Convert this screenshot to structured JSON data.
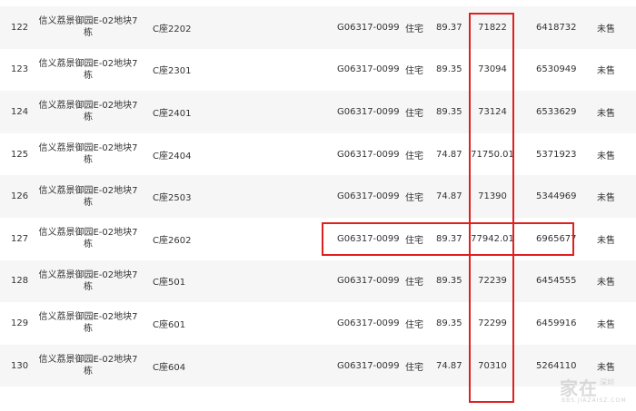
{
  "table": {
    "rows": [
      {
        "idx": "122",
        "name": "信义荔景御园E-02地块7栋",
        "unit": "C座2202",
        "code": "G06317-0099",
        "type": "住宅",
        "area": "89.37",
        "price": "71822",
        "total": "6418732",
        "status": "未售"
      },
      {
        "idx": "123",
        "name": "信义荔景御园E-02地块7栋",
        "unit": "C座2301",
        "code": "G06317-0099",
        "type": "住宅",
        "area": "89.35",
        "price": "73094",
        "total": "6530949",
        "status": "未售"
      },
      {
        "idx": "124",
        "name": "信义荔景御园E-02地块7栋",
        "unit": "C座2401",
        "code": "G06317-0099",
        "type": "住宅",
        "area": "89.35",
        "price": "73124",
        "total": "6533629",
        "status": "未售"
      },
      {
        "idx": "125",
        "name": "信义荔景御园E-02地块7栋",
        "unit": "C座2404",
        "code": "G06317-0099",
        "type": "住宅",
        "area": "74.87",
        "price": "71750.01",
        "total": "5371923",
        "status": "未售"
      },
      {
        "idx": "126",
        "name": "信义荔景御园E-02地块7栋",
        "unit": "C座2503",
        "code": "G06317-0099",
        "type": "住宅",
        "area": "74.87",
        "price": "71390",
        "total": "5344969",
        "status": "未售"
      },
      {
        "idx": "127",
        "name": "信义荔景御园E-02地块7栋",
        "unit": "C座2602",
        "code": "G06317-0099",
        "type": "住宅",
        "area": "89.37",
        "price": "77942.01",
        "total": "6965677",
        "status": "未售"
      },
      {
        "idx": "128",
        "name": "信义荔景御园E-02地块7栋",
        "unit": "C座501",
        "code": "G06317-0099",
        "type": "住宅",
        "area": "89.35",
        "price": "72239",
        "total": "6454555",
        "status": "未售"
      },
      {
        "idx": "129",
        "name": "信义荔景御园E-02地块7栋",
        "unit": "C座601",
        "code": "G06317-0099",
        "type": "住宅",
        "area": "89.35",
        "price": "72299",
        "total": "6459916",
        "status": "未售"
      },
      {
        "idx": "130",
        "name": "信义荔景御园E-02地块7栋",
        "unit": "C座604",
        "code": "G06317-0099",
        "type": "住宅",
        "area": "74.87",
        "price": "70310",
        "total": "5264110",
        "status": "未售"
      }
    ]
  },
  "annotations": {
    "color": "#e02020",
    "highlighted_column": "price",
    "highlighted_row_idx": "127"
  },
  "watermark": {
    "main": "家在",
    "sub": "深圳",
    "url": "BBS.JIAZAISZ.COM"
  }
}
